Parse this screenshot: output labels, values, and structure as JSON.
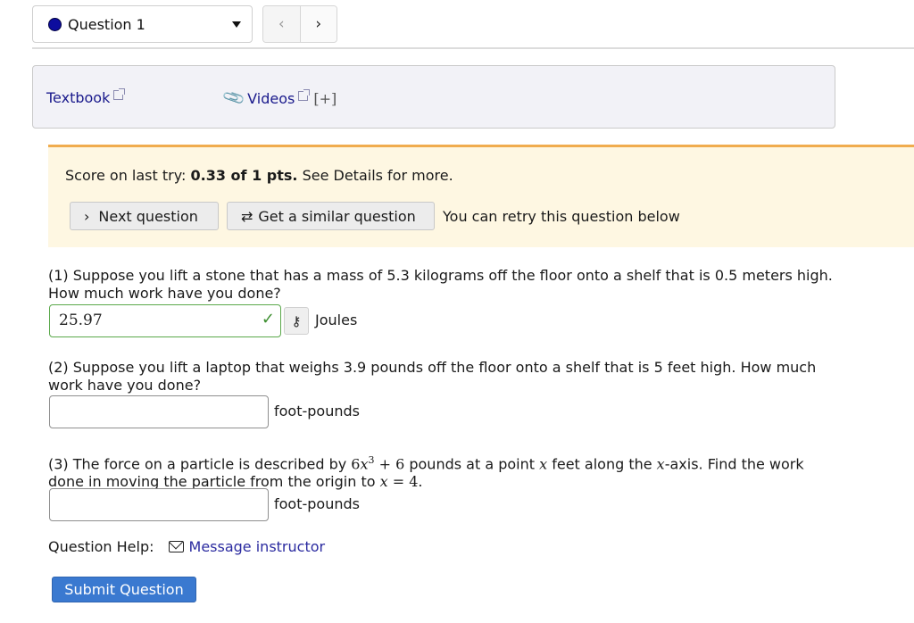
{
  "nav": {
    "question_select": "Question 1",
    "status_color": "#0d0d9e",
    "prev_icon": "‹",
    "next_icon": "›"
  },
  "resources": {
    "textbook": "Textbook",
    "videos": "Videos",
    "expand": "[+]",
    "clip_icon": "paperclip-icon",
    "external_icon": "external-link-icon"
  },
  "score": {
    "prefix": "Score on last try: ",
    "value": "0.33 of 1 pts.",
    "suffix": " See Details for more.",
    "next_question_icon": "›",
    "next_question": "Next question",
    "similar_icon": "⇄",
    "similar_question": "Get a similar question",
    "retry_text": "You can retry this question below"
  },
  "questions": [
    {
      "text": "(1) Suppose you lift a stone that has a mass of 5.3 kilograms off the floor onto a shelf that is 0.5 meters high. How much work have you done?",
      "answer": "25.97",
      "correct": true,
      "unit": "Joules"
    },
    {
      "text": "(2) Suppose you lift a laptop that weighs 3.9 pounds off the floor onto a shelf that is 5 feet high. How much work have you done?",
      "answer": "",
      "unit": "foot-pounds"
    },
    {
      "text_parts": {
        "a": "(3) The force on a particle is described by ",
        "expr_coef": "6",
        "expr_var": "x",
        "expr_exp": "3",
        "expr_rest": " + 6",
        "b": " pounds at a point ",
        "var": "x",
        "c": " feet along the ",
        "d": "-axis. Find the work done in moving the particle from the origin to ",
        "eq": " = 4."
      },
      "answer": "",
      "unit": "foot-pounds"
    }
  ],
  "help": {
    "label": "Question Help:",
    "message_link": "Message instructor"
  },
  "submit_label": "Submit Question",
  "colors": {
    "score_accent": "#f0ac4e",
    "submit": "#3a79d0",
    "correct": "#5aa84a",
    "link": "#1a1a8c"
  }
}
